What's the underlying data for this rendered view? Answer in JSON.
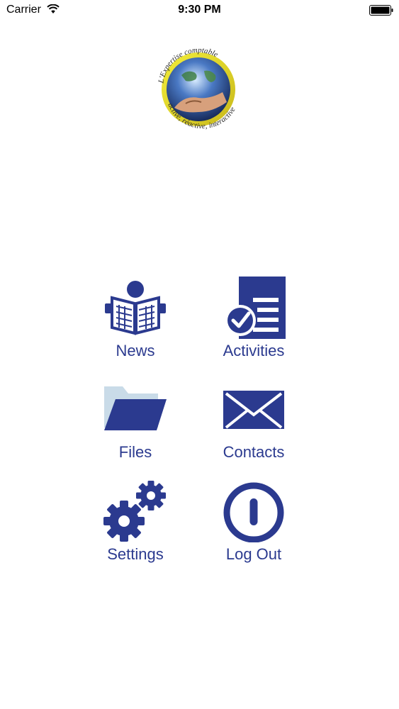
{
  "status_bar": {
    "carrier": "Carrier",
    "time": "9:30 PM"
  },
  "logo": {
    "top_text": "L'Expertise comptable",
    "bottom_text": "active, réactive, interactive"
  },
  "menu": [
    {
      "label": "News",
      "icon": "newspaper-reader-icon"
    },
    {
      "label": "Activities",
      "icon": "checklist-document-icon"
    },
    {
      "label": "Files",
      "icon": "folder-icon"
    },
    {
      "label": "Contacts",
      "icon": "envelope-icon"
    },
    {
      "label": "Settings",
      "icon": "gears-icon"
    },
    {
      "label": "Log Out",
      "icon": "power-icon"
    }
  ],
  "colors": {
    "accent": "#2b3a8f",
    "folder_back": "#c9dbe8"
  }
}
